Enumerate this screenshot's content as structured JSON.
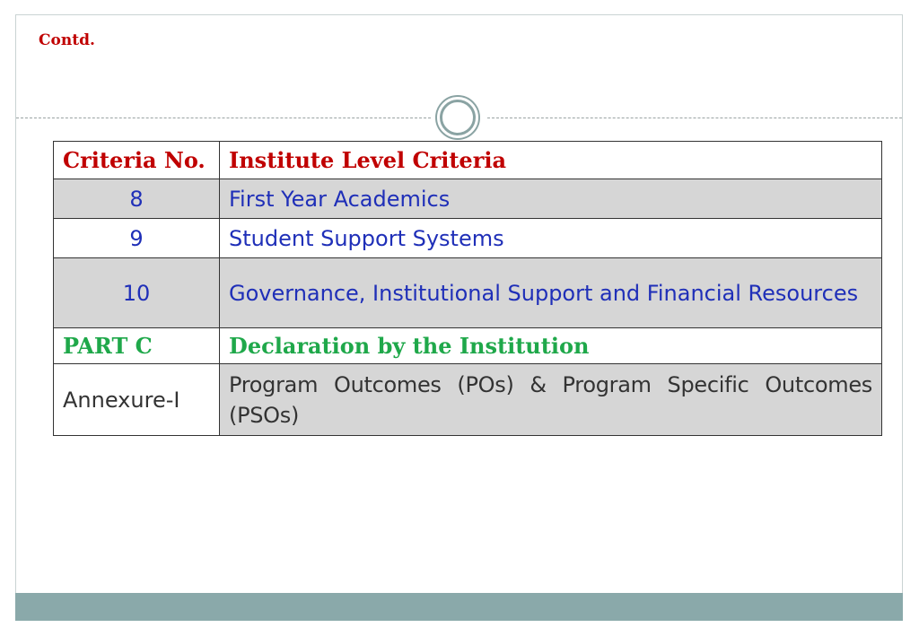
{
  "slide": {
    "heading": "Contd."
  },
  "table": {
    "headers": [
      "Criteria No.",
      "Institute Level Criteria"
    ],
    "rows": [
      {
        "number": "8",
        "criteria": "First Year Academics"
      },
      {
        "number": "9",
        "criteria": "Student Support Systems"
      },
      {
        "number": "10",
        "criteria": "Governance, Institutional Support and Financial Resources"
      },
      {
        "number": "PART C",
        "criteria": "Declaration by the Institution"
      },
      {
        "number": "Annexure-I",
        "criteria": "Program Outcomes (POs) & Program Specific Outcomes (PSOs)"
      }
    ]
  },
  "colors": {
    "heading": "#c00000",
    "blue_text": "#1f2fb8",
    "green_text": "#1fa84a",
    "row_gray": "#d6d6d6",
    "bottom_bar": "#8aa9aa"
  }
}
